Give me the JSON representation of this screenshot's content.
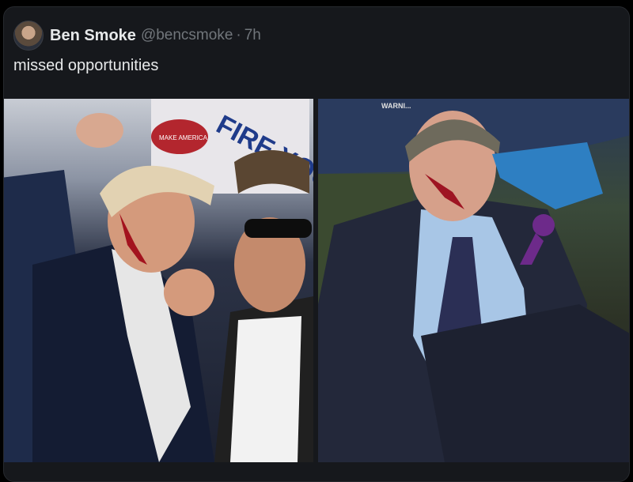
{
  "tweet": {
    "author_name": "Ben Smoke",
    "handle": "@bencsmoke",
    "separator": "·",
    "time": "7h",
    "text": "missed opportunities"
  },
  "media": {
    "left_sign_text": "FIRE YOU",
    "left_hat_text": "MAKE AMERICA",
    "right_roof_text": "WARNI..."
  },
  "colors": {
    "background": "#000000",
    "card": "#16181c",
    "primary_text": "#e7e9ea",
    "secondary_text": "#71767b"
  }
}
